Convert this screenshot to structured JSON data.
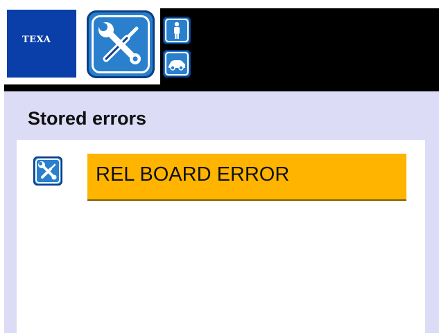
{
  "header": {
    "logo_text": "TEXA",
    "icons": {
      "main": "wrench-screwdriver-icon",
      "person": "person-icon",
      "vehicle": "car-icon"
    }
  },
  "page": {
    "title": "Stored errors"
  },
  "errors": [
    {
      "icon": "wrench-screwdriver-icon",
      "label": "REL BOARD ERROR",
      "selected": true
    }
  ],
  "colors": {
    "brand_blue": "#0a3ea8",
    "icon_blue": "#2a80cc",
    "band": "#dcdcf6",
    "selection": "#ffb400"
  }
}
